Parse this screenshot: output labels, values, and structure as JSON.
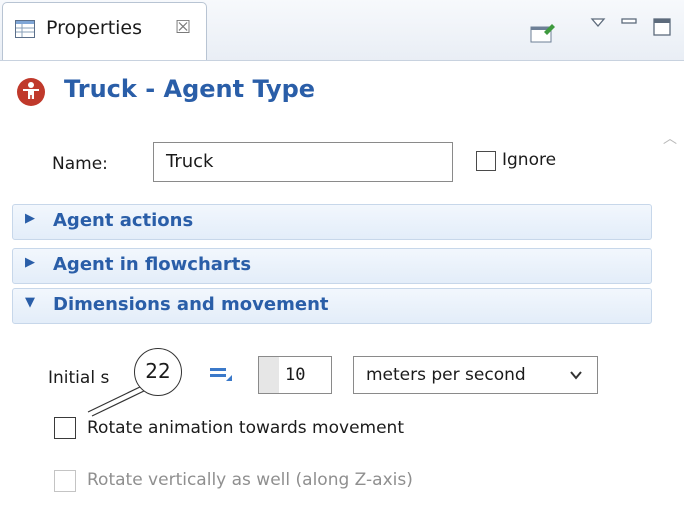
{
  "view": {
    "tab_label": "Properties",
    "tab_close_glyph": "☒"
  },
  "header": {
    "title": "Truck - Agent Type"
  },
  "name_row": {
    "label": "Name:",
    "value": "Truck",
    "ignore_label": "Ignore",
    "ignore_checked": false
  },
  "sections": [
    {
      "label": "Agent actions",
      "expanded": false
    },
    {
      "label": "Agent in flowcharts",
      "expanded": false
    },
    {
      "label": "Dimensions and movement",
      "expanded": true
    }
  ],
  "dimensions": {
    "initial_speed_label": "Initial s",
    "initial_speed_value": "10",
    "speed_unit": "meters per second",
    "rotate_label": "Rotate animation towards movement",
    "rotate_checked": false,
    "rotate_vertical_label": "Rotate vertically as well (along Z-axis)",
    "rotate_vertical_checked": false,
    "rotate_vertical_enabled": false
  },
  "callout": {
    "number": "22"
  },
  "colors": {
    "accent": "#2a5ea8",
    "agent_icon": "#c0392b"
  }
}
